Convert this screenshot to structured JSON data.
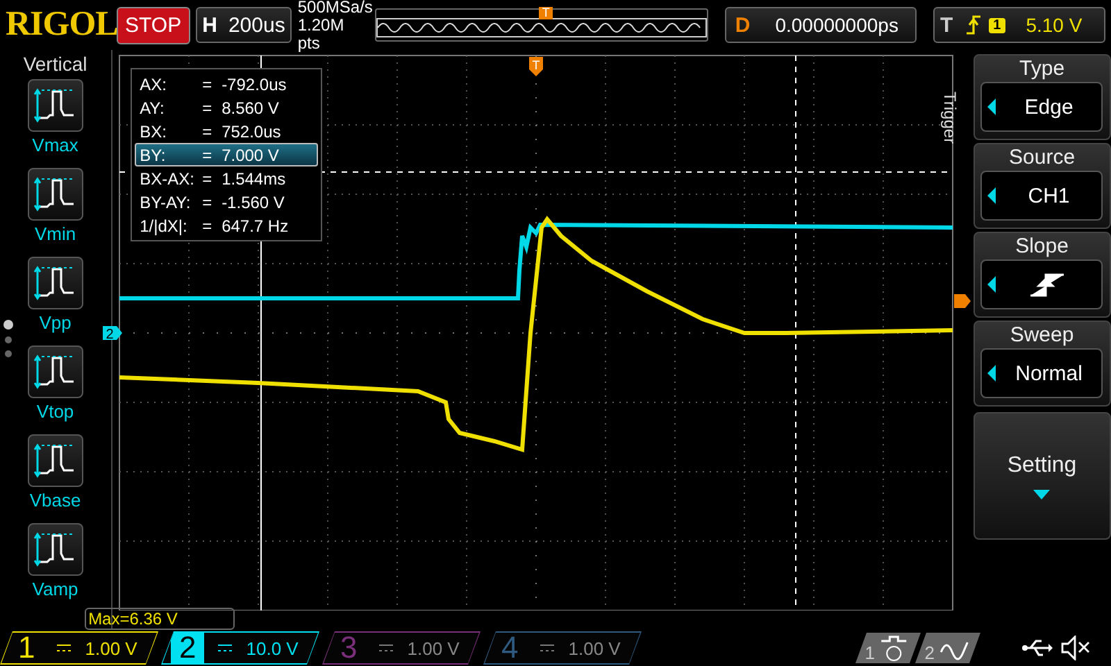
{
  "brand": "RIGOL",
  "run_state": "STOP",
  "horizontal": {
    "label": "H",
    "timebase": "200us",
    "sample_rate": "500MSa/s",
    "memory_depth": "1.20M pts",
    "marker": "T"
  },
  "delay": {
    "label": "D",
    "value": "0.00000000ps"
  },
  "trigger": {
    "label": "T",
    "channel": "1",
    "level": "5.10 V"
  },
  "left_menu": {
    "title": "Vertical",
    "items": [
      {
        "label": "Vmax"
      },
      {
        "label": "Vmin"
      },
      {
        "label": "Vpp"
      },
      {
        "label": "Vtop"
      },
      {
        "label": "Vbase"
      },
      {
        "label": "Vamp"
      }
    ]
  },
  "grid": {
    "trigger_marker": "T",
    "channel_marker": "2"
  },
  "cursor_readout": [
    {
      "name": "AX:",
      "eq": "=",
      "value": "-792.0us",
      "selected": false
    },
    {
      "name": "AY:",
      "eq": "=",
      "value": "8.560 V",
      "selected": false
    },
    {
      "name": "BX:",
      "eq": "=",
      "value": "752.0us",
      "selected": false
    },
    {
      "name": "BY:",
      "eq": "=",
      "value": "7.000 V",
      "selected": true
    },
    {
      "name": "BX-AX:",
      "eq": "=",
      "value": "1.544ms",
      "selected": false
    },
    {
      "name": "BY-AY:",
      "eq": "=",
      "value": "-1.560 V",
      "selected": false
    },
    {
      "name": "1/|dX|:",
      "eq": "=",
      "value": "647.7 Hz",
      "selected": false
    }
  ],
  "max_readout": "Max=6.36 V",
  "trigger_menu": {
    "title": "Trigger",
    "items": [
      {
        "label": "Type",
        "kind": "value",
        "value": "Edge"
      },
      {
        "label": "Source",
        "kind": "value",
        "value": "CH1"
      },
      {
        "label": "Slope",
        "kind": "slope"
      },
      {
        "label": "Sweep",
        "kind": "value",
        "value": "Normal"
      },
      {
        "label": "Setting",
        "kind": "more"
      }
    ]
  },
  "channels": [
    {
      "number": "1",
      "scale": "1.00 V",
      "enabled": true,
      "selected": false,
      "color": "#f0e000"
    },
    {
      "number": "2",
      "scale": "10.0 V",
      "enabled": true,
      "selected": true,
      "color": "#00e0f0"
    },
    {
      "number": "3",
      "scale": "1.00 V",
      "enabled": false,
      "selected": false,
      "color": "#7a2f7a"
    },
    {
      "number": "4",
      "scale": "1.00 V",
      "enabled": false,
      "selected": false,
      "color": "#2f5a80"
    }
  ],
  "status_icons": [
    {
      "label": "1",
      "kind": "motor"
    },
    {
      "label": "2",
      "kind": "wave"
    }
  ]
}
